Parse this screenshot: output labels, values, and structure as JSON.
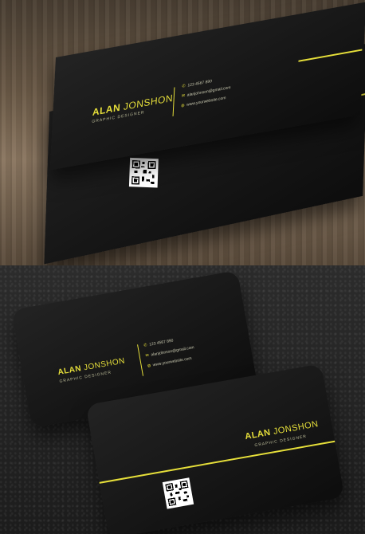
{
  "card": {
    "first_name": "ALAN",
    "last_name": "JONSHON",
    "role": "GRAPHIC DESIGNER",
    "phone": "123 4567 890",
    "email": "alanjohnson@gmail.com",
    "website": "www.yourwebsite.com"
  },
  "colors": {
    "accent": "#e6df3a",
    "card": "#141414"
  },
  "icons": [
    "phone-icon",
    "email-icon",
    "globe-icon"
  ]
}
